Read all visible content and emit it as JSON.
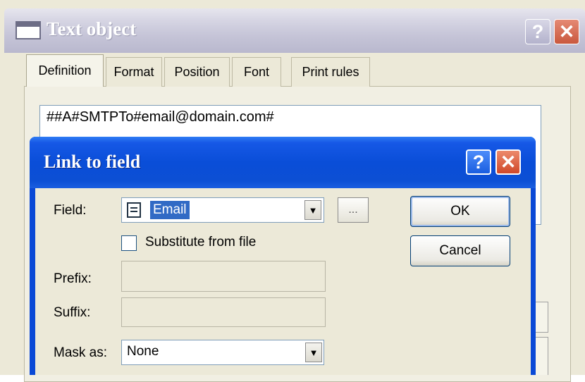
{
  "outer_window": {
    "title": "Text object",
    "help_glyph": "?",
    "close_glyph": "✕",
    "tabs": [
      {
        "label": "Definition"
      },
      {
        "label": "Format"
      },
      {
        "label": "Position"
      },
      {
        "label": "Font"
      },
      {
        "label": "Print rules"
      }
    ],
    "definition_text": "##A#SMTPTo#email@domain.com#"
  },
  "dialog": {
    "title": "Link to field",
    "help_glyph": "?",
    "close_glyph": "✕",
    "field_label": "Field:",
    "field_value": "Email",
    "browse_label": "...",
    "substitute_label": "Substitute from file",
    "prefix_label": "Prefix:",
    "suffix_label": "Suffix:",
    "mask_label": "Mask as:",
    "mask_value": "None",
    "ok_label": "OK",
    "cancel_label": "Cancel",
    "dropdown_glyph": "▼"
  },
  "colors": {
    "inner_titlebar": "#0a4ed8",
    "selection": "#316ac5",
    "outer_close": "#c9583e",
    "inner_close": "#d0492a"
  },
  "icons": {
    "outer_title_icon": "window-icon",
    "field_icon": "document-icon"
  }
}
